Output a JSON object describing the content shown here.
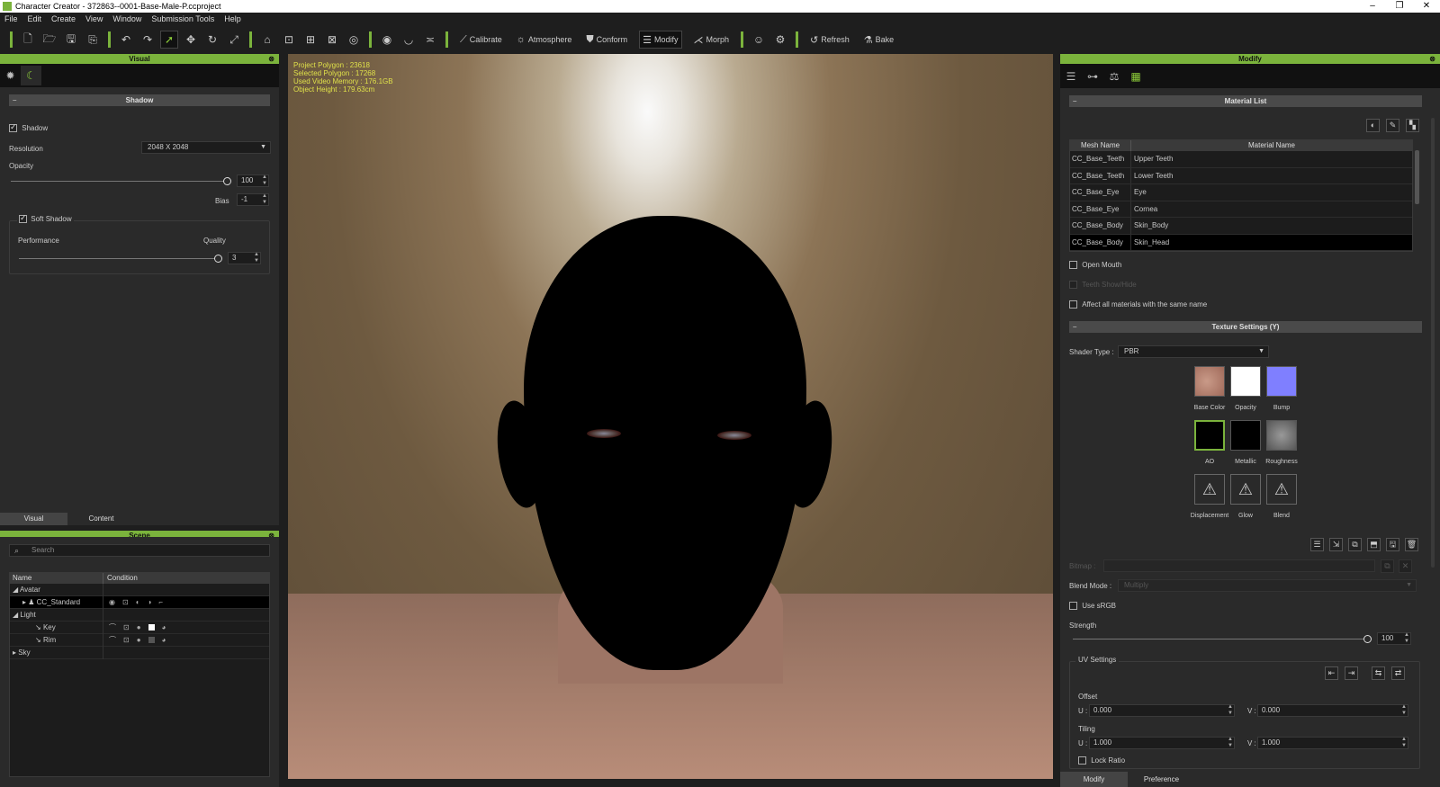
{
  "window": {
    "title": "Character Creator - 372863--0001-Base-Male-P.ccproject"
  },
  "menu": [
    "File",
    "Edit",
    "Create",
    "View",
    "Window",
    "Submission Tools",
    "Help"
  ],
  "toolbar": {
    "calibrate": "Calibrate",
    "atmosphere": "Atmosphere",
    "conform": "Conform",
    "modify": "Modify",
    "morph": "Morph",
    "refresh": "Refresh",
    "bake": "Bake"
  },
  "visual_panel": {
    "title": "Visual",
    "shadow_section": "Shadow",
    "shadow_label": "Shadow",
    "resolution_label": "Resolution",
    "resolution_value": "2048  X  2048",
    "opacity_label": "Opacity",
    "opacity_value": "100",
    "bias_label": "Bias",
    "bias_value": "-1",
    "soft_shadow_label": "Soft Shadow",
    "performance_label": "Performance",
    "quality_label": "Quality",
    "quality_value": "3"
  },
  "left_tabs": {
    "visual": "Visual",
    "content": "Content"
  },
  "scene_panel": {
    "title": "Scene",
    "search_placeholder": "Search",
    "col_name": "Name",
    "col_condition": "Condition",
    "rows": {
      "avatar": "Avatar",
      "cc_standard": "CC_Standard",
      "light": "Light",
      "key": "Key",
      "rim": "Rim",
      "sky": "Sky"
    }
  },
  "viewport": {
    "info": [
      "Project Polygon : 23618",
      "Selected Polygon : 17268",
      "Used Video Memory : 176.1GB",
      "Object Height : 179.63cm"
    ]
  },
  "modify_panel": {
    "title": "Modify",
    "material_list_title": "Material List",
    "col_mesh": "Mesh Name",
    "col_material": "Material Name",
    "materials": [
      {
        "mesh": "CC_Base_Teeth",
        "material": "Upper Teeth"
      },
      {
        "mesh": "CC_Base_Teeth",
        "material": "Lower Teeth"
      },
      {
        "mesh": "CC_Base_Eye",
        "material": "Eye"
      },
      {
        "mesh": "CC_Base_Eye",
        "material": "Cornea"
      },
      {
        "mesh": "CC_Base_Body",
        "material": "Skin_Body"
      },
      {
        "mesh": "CC_Base_Body",
        "material": "Skin_Head"
      }
    ],
    "open_mouth": "Open Mouth",
    "teeth_show_hide": "Teeth Show/Hide",
    "affect_all": "Affect all materials with the same name",
    "texture_settings_title": "Texture Settings (Y)",
    "shader_type_label": "Shader Type :",
    "shader_type_value": "PBR",
    "textures": {
      "base_color": "Base Color",
      "opacity": "Opacity",
      "bump": "Bump",
      "ao": "AO",
      "metallic": "Metallic",
      "roughness": "Roughness",
      "displacement": "Displacement",
      "glow": "Glow",
      "blend": "Blend"
    },
    "bitmap_label": "Bitmap :",
    "blend_mode_label": "Blend Mode :",
    "blend_mode_value": "Multiply",
    "use_srgb": "Use sRGB",
    "strength_label": "Strength",
    "strength_value": "100",
    "uv_settings_label": "UV Settings",
    "offset_label": "Offset",
    "u_label": "U :",
    "v_label": "V :",
    "offset_u": "0.000",
    "offset_v": "0.000",
    "tiling_label": "Tiling",
    "tiling_u": "1.000",
    "tiling_v": "1.000",
    "lock_ratio": "Lock Ratio"
  },
  "right_tabs": {
    "modify": "Modify",
    "preference": "Preference"
  },
  "colors": {
    "accent": "#7bb33c",
    "panel": "#2a2a2a",
    "info_text": "#dfe04a"
  }
}
